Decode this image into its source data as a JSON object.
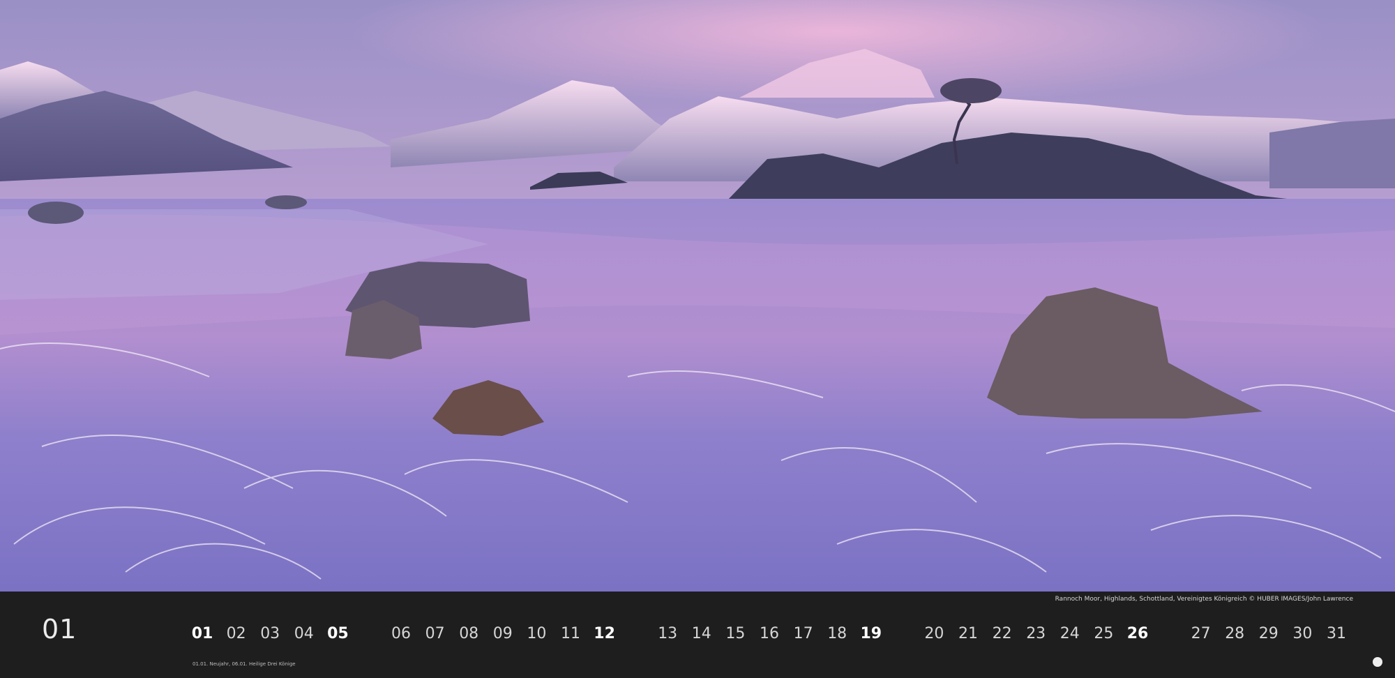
{
  "calendar": {
    "month": "01",
    "credit": "Rannoch Moor, Highlands, Schottland, Vereinigtes Königreich © HUBER IMAGES/John Lawrence",
    "holidays": "01.01. Neujahr, 06.01. Heilige Drei Könige",
    "days": [
      {
        "label": "01",
        "bold": true
      },
      {
        "label": "02",
        "bold": false
      },
      {
        "label": "03",
        "bold": false
      },
      {
        "label": "04",
        "bold": false
      },
      {
        "label": "05",
        "bold": true
      },
      {
        "label": "06",
        "bold": false
      },
      {
        "label": "07",
        "bold": false
      },
      {
        "label": "08",
        "bold": false
      },
      {
        "label": "09",
        "bold": false
      },
      {
        "label": "10",
        "bold": false
      },
      {
        "label": "11",
        "bold": false
      },
      {
        "label": "12",
        "bold": true
      },
      {
        "label": "13",
        "bold": false
      },
      {
        "label": "14",
        "bold": false
      },
      {
        "label": "15",
        "bold": false
      },
      {
        "label": "16",
        "bold": false
      },
      {
        "label": "17",
        "bold": false
      },
      {
        "label": "18",
        "bold": false
      },
      {
        "label": "19",
        "bold": true
      },
      {
        "label": "20",
        "bold": false
      },
      {
        "label": "21",
        "bold": false
      },
      {
        "label": "22",
        "bold": false
      },
      {
        "label": "23",
        "bold": false
      },
      {
        "label": "24",
        "bold": false
      },
      {
        "label": "25",
        "bold": false
      },
      {
        "label": "26",
        "bold": true
      },
      {
        "label": "27",
        "bold": false
      },
      {
        "label": "28",
        "bold": false
      },
      {
        "label": "29",
        "bold": false
      },
      {
        "label": "30",
        "bold": false
      },
      {
        "label": "31",
        "bold": false
      }
    ]
  },
  "colors": {
    "sky_top": "#9c8fc4",
    "sky_glow": "#e7b6d8",
    "water": "#8877c4",
    "strip": "#1e1e1e"
  }
}
